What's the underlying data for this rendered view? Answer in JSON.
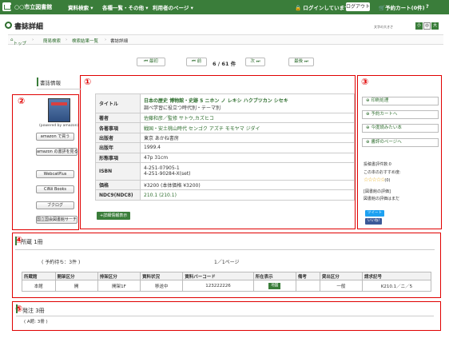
{
  "topbar": {
    "site_title": "○○市立図書館",
    "menu": [
      "資料検索 ▾",
      "各種一覧・その他 ▾",
      "利用者のページ ▾"
    ],
    "login_status": "ログインしています",
    "logout_label": "ログアウト",
    "cart_label": "予約カート(0件)",
    "help_label": "?"
  },
  "page": {
    "title": "書誌詳細",
    "fontsize_label": "文字の大きさ",
    "font_sizes": [
      "小",
      "中",
      "大"
    ]
  },
  "breadcrumb": [
    "トップ",
    "簡易検索",
    "検索結果一覧",
    "書誌詳細"
  ],
  "pager": {
    "first": "最初",
    "prev": "前",
    "info": "6 / 61 件",
    "next": "次",
    "last": "最後"
  },
  "markers": [
    "①",
    "②",
    "③",
    "④",
    "⑤"
  ],
  "left_panel": {
    "label": "書誌情報",
    "powered_by": "(powered by amazon)",
    "buttons": [
      "amazon で買う",
      "amazon の書評を見る",
      "WebcatPlus",
      "CiNii Books",
      "ブクログ",
      "国立国会図書館サーチ"
    ]
  },
  "detail": {
    "rows": [
      {
        "label": "タイトル",
        "value": "日本の歴史 博物館・史跡 5 ニホン ノ レキシ ハクブツカン シセキ",
        "value2": "調べ学習に役立つ時代別・テーマ別"
      },
      {
        "label": "著者",
        "value": "佐藤和彦／監修 サトウ,カズヒコ"
      },
      {
        "label": "各著事項",
        "value": "戦国・安土桃山時代 センゴク アズチ モモヤマ ジダイ"
      },
      {
        "label": "出版者",
        "value": "東京 あかね書房"
      },
      {
        "label": "出版年",
        "value": "1999.4"
      },
      {
        "label": "形態事項",
        "value": "47p 31cm"
      },
      {
        "label": "ISBN",
        "value": "4-251-07905-1",
        "value2": "4-251-90284-X(set)"
      },
      {
        "label": "価格",
        "value": "¥3200 (本体価格 ¥3200)"
      },
      {
        "label": "NDC9(NDC8)",
        "value": "210.1 (210.1)"
      }
    ],
    "more_label": "+詳細情報表示"
  },
  "right_panel": {
    "buttons": [
      "印刷処理",
      "予約カートへ",
      "今度読みたい本",
      "書評のページへ"
    ],
    "review_count": "投稿書評件数:0",
    "rating_label": "この本のおすすめ度:",
    "stars": "☆☆☆☆☆",
    "rating_count": "(0)",
    "review_line1": "[図書館の評価]",
    "review_line2": "図書館の評価はまだ",
    "tweet": "ツイート",
    "like": "いいね!"
  },
  "holdings": {
    "title": "所蔵 1冊",
    "reserve": "( 予約待ち：3件 )",
    "page": "1／1ページ",
    "headers": [
      "所蔵館",
      "開架区分",
      "排架区分",
      "資料状況",
      "資料バーコード",
      "所在表示",
      "備考",
      "貸出区分",
      "請求記号"
    ],
    "row": [
      "本館",
      "開",
      "開架1F",
      "移送中",
      "123222226",
      "地図",
      "",
      "一般",
      "K210.1／ニ／5"
    ]
  },
  "orders": {
    "title": "発注 3冊",
    "sub": "( A館: 3冊 )"
  }
}
